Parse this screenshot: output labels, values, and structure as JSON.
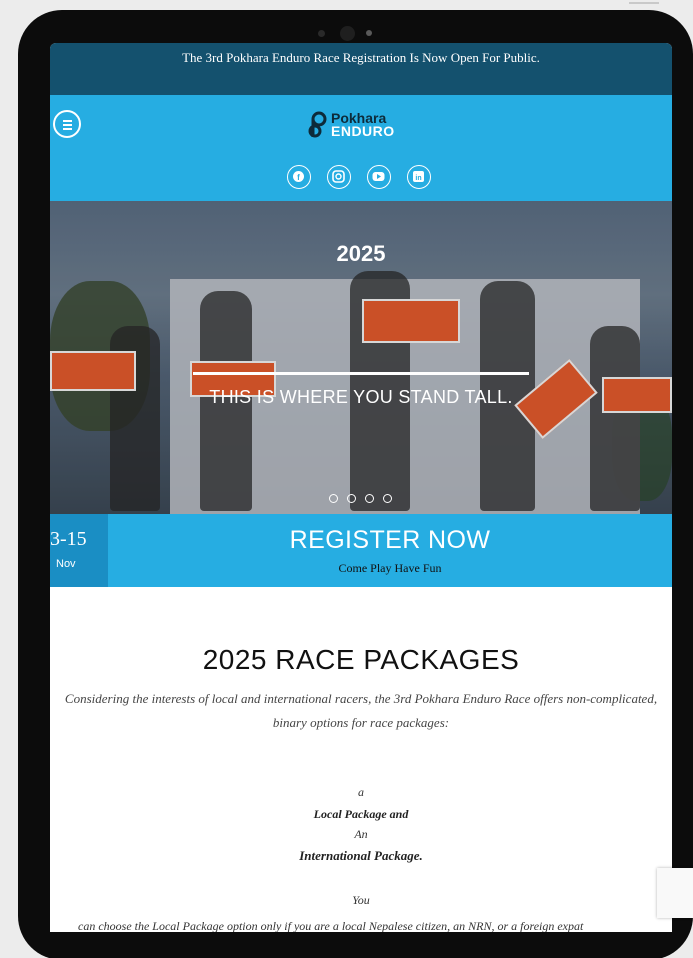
{
  "announcement": {
    "text": "The 3rd Pokhara Enduro Race Registration Is Now Open For Public."
  },
  "header": {
    "logo": {
      "line1": "Pokhara",
      "line2": "ENDURO"
    },
    "menu_icon": "hamburger-menu-icon",
    "social_icons": [
      "facebook-icon",
      "instagram-icon",
      "youtube-icon",
      "linkedin-icon"
    ]
  },
  "hero": {
    "year": "2025",
    "tagline": "THIS IS WHERE YOU STAND TALL.",
    "slide_count": 4
  },
  "register": {
    "date_range": "3-15",
    "month": "Nov",
    "title": "REGISTER NOW",
    "subtitle": "Come Play Have Fun"
  },
  "packages": {
    "title": "2025 RACE PACKAGES",
    "intro": "Considering the interests of local and international racers, the 3rd Pokhara Enduro Race offers non-complicated, binary options for race packages:",
    "a": "a",
    "local": "Local Package and",
    "an": "An",
    "international": "International Package.",
    "you": "You",
    "choose_local": "can choose the Local Package option only if you are a local Nepalese citizen, an NRN, or a foreign expat"
  },
  "colors": {
    "announcement_bg": "#14516e",
    "accent": "#26ade2",
    "date_bg": "#1a8ec4"
  }
}
